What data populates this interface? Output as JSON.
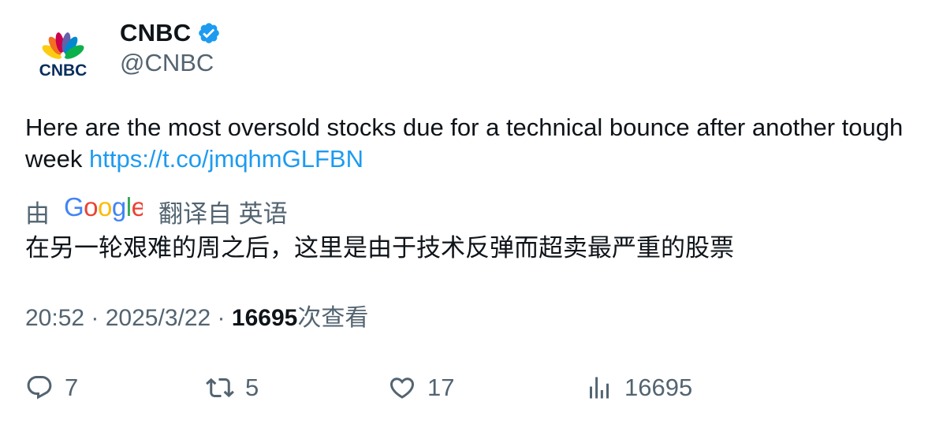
{
  "author": {
    "display_name": "CNBC",
    "handle": "@CNBC",
    "verified": true,
    "avatar_logo_text": "CNBC",
    "verified_color": "#1d9bf0"
  },
  "tweet": {
    "text": "Here are the most oversold stocks due for a technical bounce after another tough week ",
    "link": "https://t.co/jmqhmGLFBN"
  },
  "translation": {
    "prefix": "由",
    "provider": "Google",
    "suffix": "翻译自 英语",
    "text": "在另一轮艰难的周之后，这里是由于技术反弹而超卖最严重的股票"
  },
  "meta": {
    "time": "20:52",
    "separator": " · ",
    "date": "2025/3/22",
    "views_count": "16695",
    "views_label": "次查看"
  },
  "actions": {
    "replies": "7",
    "retweets": "5",
    "likes": "17",
    "views": "16695"
  },
  "colors": {
    "text": "#0f1419",
    "secondary": "#536471",
    "link": "#1d9bf0"
  }
}
